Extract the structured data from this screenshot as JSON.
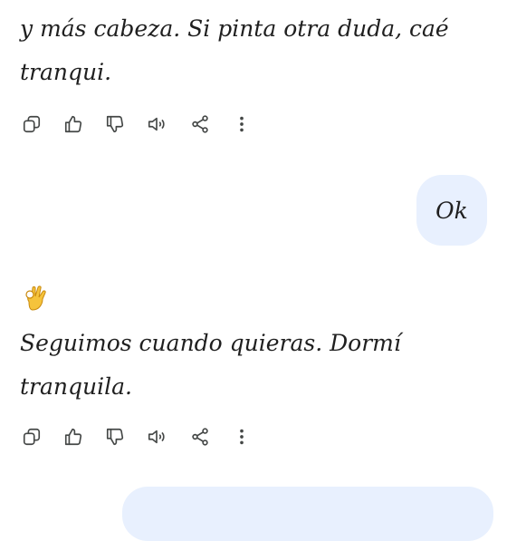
{
  "messages": [
    {
      "role": "assistant",
      "text_lines": [
        "y más cabeza. Si pinta otra duda, caé",
        "tranqui."
      ]
    },
    {
      "role": "user",
      "text": "Ok"
    },
    {
      "role": "assistant",
      "emoji": "ok-hand-emoji",
      "text_lines": [
        "Seguimos cuando quieras. Dormí",
        "tranquila."
      ]
    }
  ],
  "action_icons": [
    "copy-icon",
    "thumbs-up-icon",
    "thumbs-down-icon",
    "speaker-icon",
    "share-icon",
    "more-vert-icon"
  ],
  "colors": {
    "background": "#ffffff",
    "user_bubble": "#e8f0fe",
    "text": "#1f1f1f",
    "icon": "#444746",
    "emoji": "#f5c33b"
  }
}
